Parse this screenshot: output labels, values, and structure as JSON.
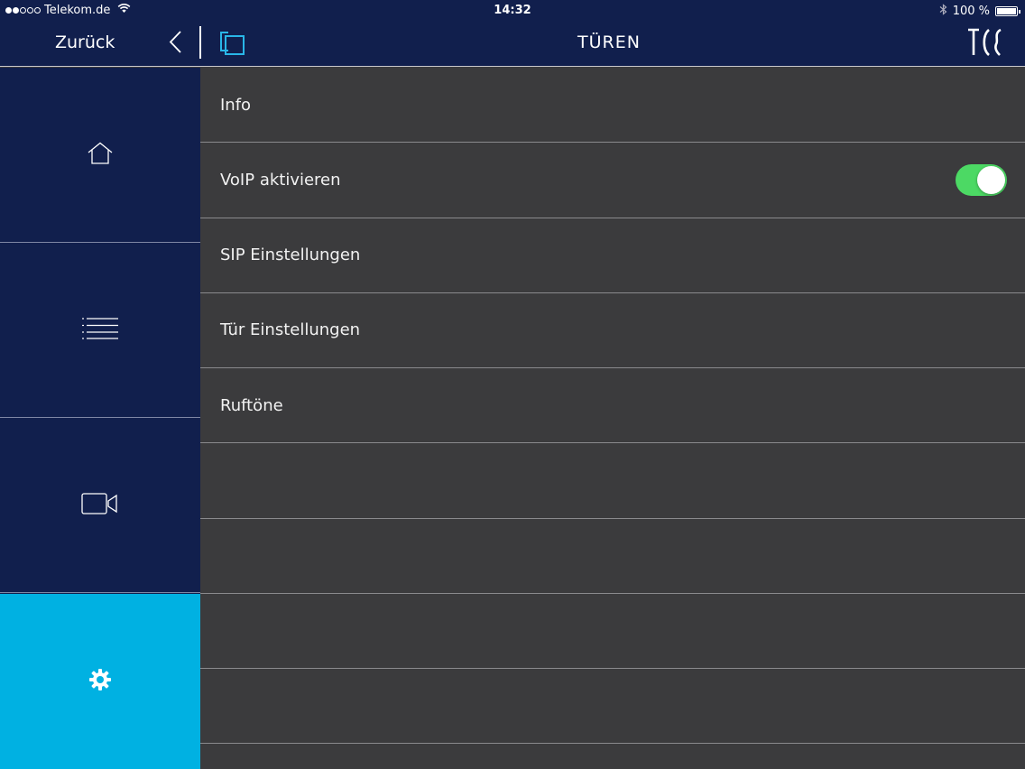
{
  "status_bar": {
    "carrier": "Telekom.de",
    "time": "14:32",
    "battery": "100 %",
    "battery_level": 1.0
  },
  "nav": {
    "back_label": "Zurück",
    "title": "TÜREN",
    "logo_text": "TCS"
  },
  "sidebar": {
    "items": [
      {
        "icon": "home-icon",
        "active": false
      },
      {
        "icon": "list-icon",
        "active": false
      },
      {
        "icon": "video-camera-icon",
        "active": false
      },
      {
        "icon": "gear-icon",
        "active": true
      }
    ]
  },
  "menu": {
    "rows": [
      {
        "label": "Info"
      },
      {
        "label": "VoIP aktivieren",
        "toggle": true,
        "toggle_on": true
      },
      {
        "label": "SIP Einstellungen"
      },
      {
        "label": "Tür Einstellungen"
      },
      {
        "label": "Ruftöne"
      },
      {
        "label": ""
      },
      {
        "label": ""
      },
      {
        "label": ""
      },
      {
        "label": ""
      }
    ]
  },
  "colors": {
    "nav_background": "#111f4d",
    "accent": "#00b1e2",
    "content_background": "#3b3b3d",
    "toggle_on": "#4cd964"
  }
}
